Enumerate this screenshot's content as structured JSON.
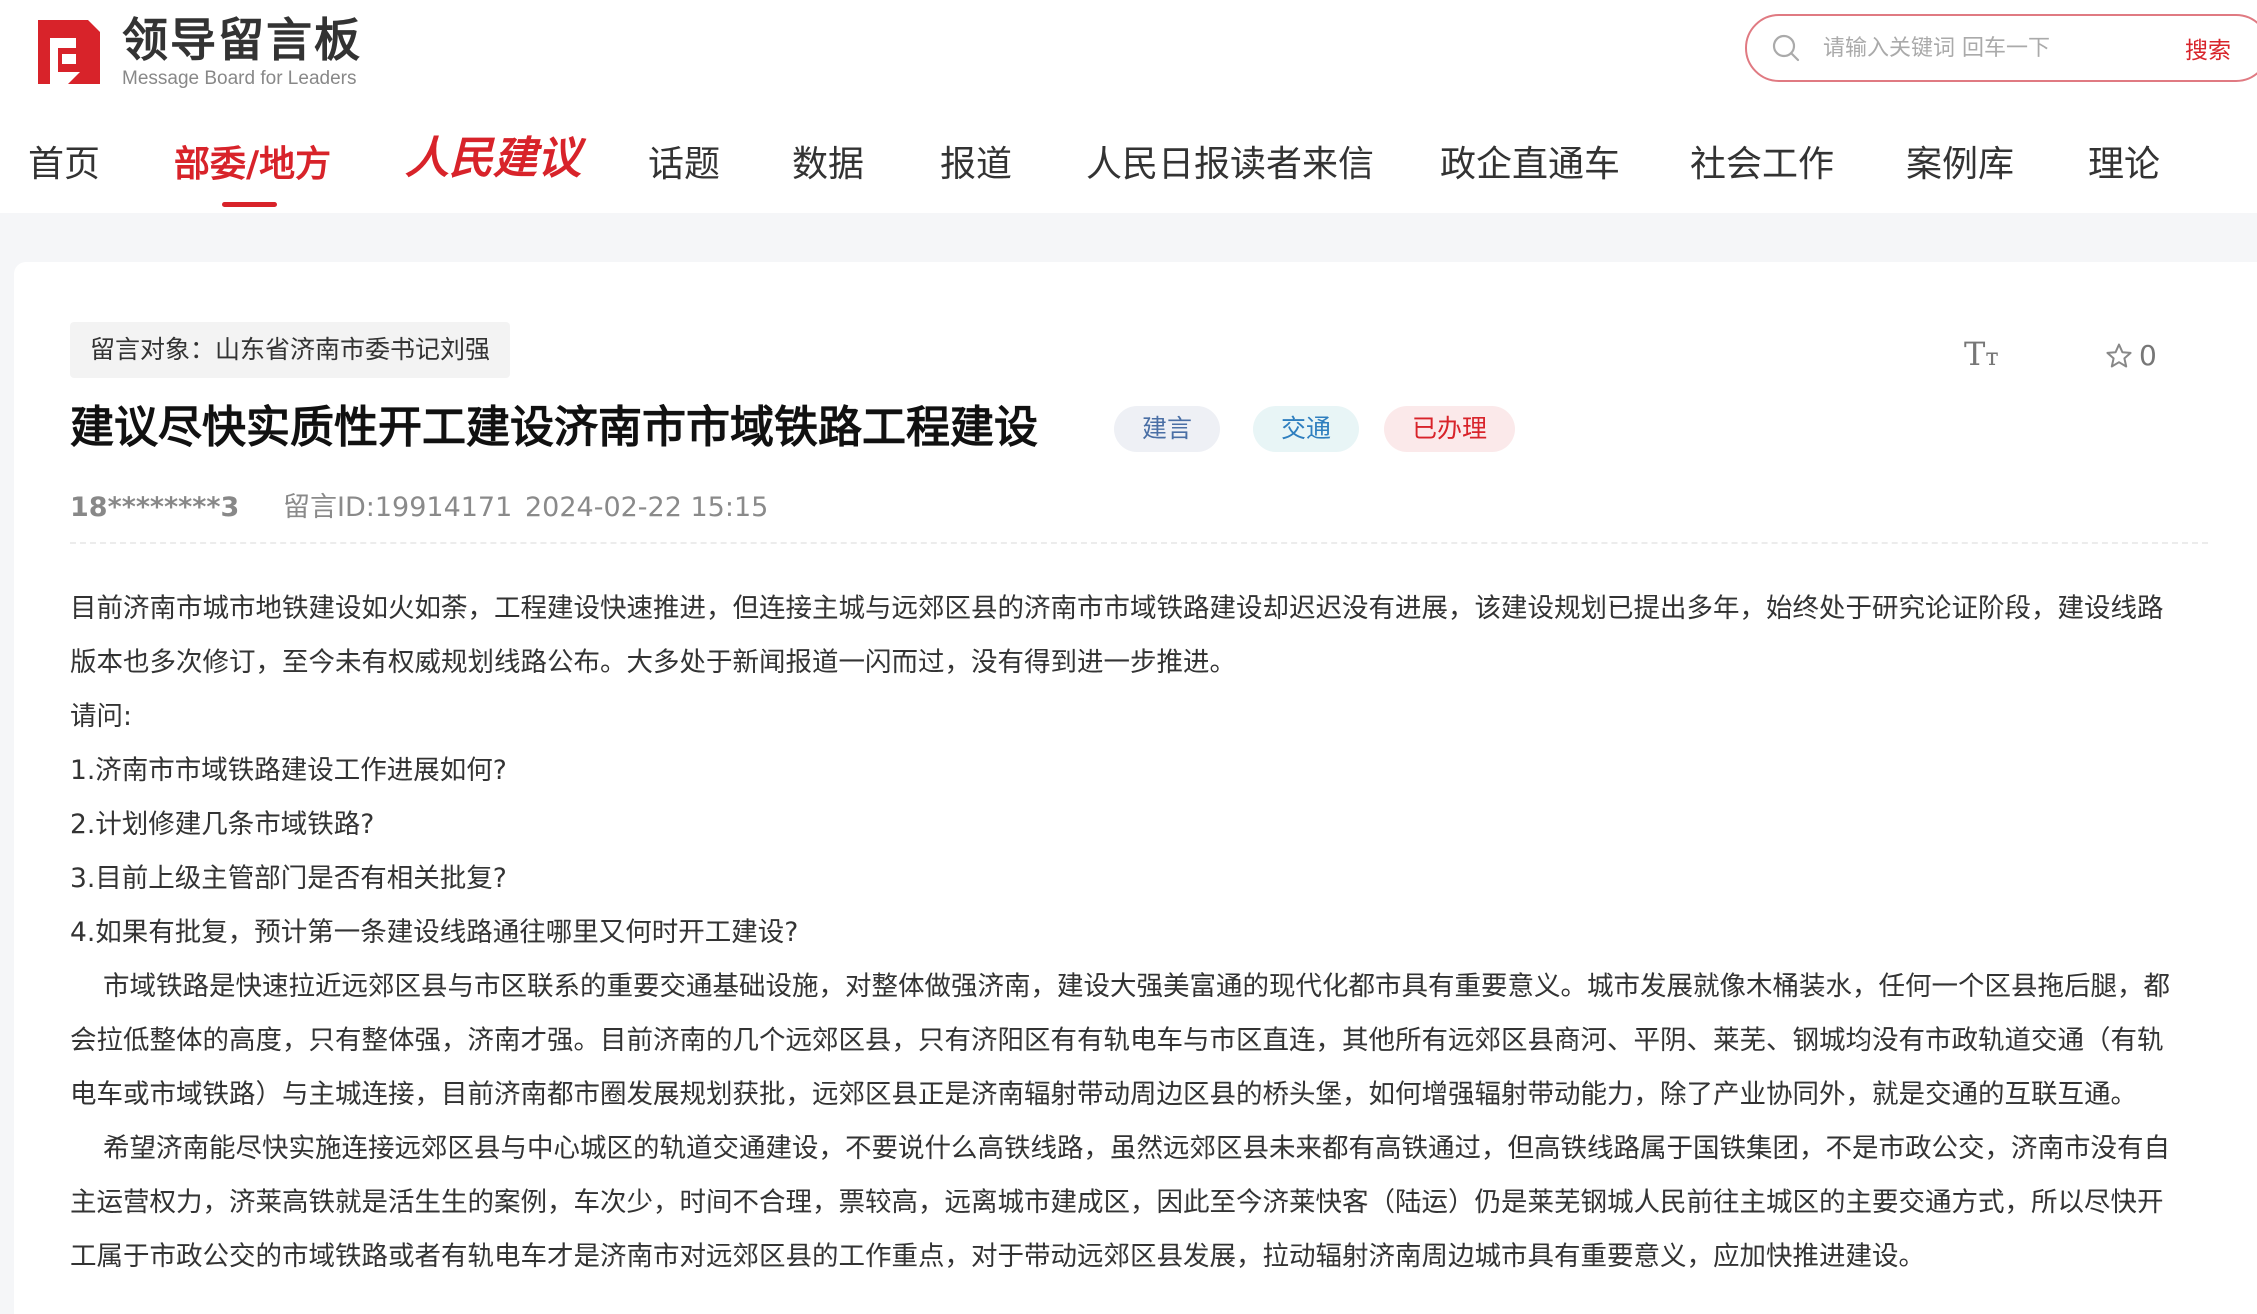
{
  "brand": {
    "logo_cn": "领导留言板",
    "logo_en": "Message Board for Leaders",
    "accent_color": "#d8232a"
  },
  "search": {
    "placeholder": "请输入关键词 回车一下",
    "button_label": "搜索",
    "icon": "search-icon"
  },
  "nav": {
    "items": [
      {
        "label": "首页"
      },
      {
        "label": "部委/地方",
        "active": true
      },
      {
        "label": "人民建议"
      },
      {
        "label": "话题"
      },
      {
        "label": "数据"
      },
      {
        "label": "报道"
      },
      {
        "label": "人民日报读者来信"
      },
      {
        "label": "政企直通车"
      },
      {
        "label": "社会工作"
      },
      {
        "label": "案例库"
      },
      {
        "label": "理论"
      }
    ]
  },
  "message": {
    "target": "留言对象：山东省济南市委书记刘强",
    "font_size_button": "Tт",
    "favorite_count": "0",
    "title": "建议尽快实质性开工建设济南市市域铁路工程建设",
    "badges": [
      "建言",
      "交通",
      "已办理"
    ],
    "user": "18********3",
    "message_id": "留言ID:19914171",
    "datetime": "2024-02-22 15:15",
    "body_lines": [
      "目前济南市城市地铁建设如火如荼，工程建设快速推进，但连接主城与远郊区县的济南市市域铁路建设却迟迟没有进展，该建设规划已提出多年，始终处于研究论证阶段，建设线路",
      "版本也多次修订，至今未有权威规划线路公布。大多处于新闻报道一闪而过，没有得到进一步推进。",
      "请问:",
      "1.济南市市域铁路建设工作进展如何?",
      "2.计划修建几条市域铁路?",
      "3.目前上级主管部门是否有相关批复?",
      "4.如果有批复，预计第一条建设线路通往哪里又何时开工建设?",
      "市域铁路是快速拉近远郊区县与市区联系的重要交通基础设施，对整体做强济南，建设大强美富通的现代化都市具有重要意义。城市发展就像木桶装水，任何一个区县拖后腿，都",
      "会拉低整体的高度，只有整体强，济南才强。目前济南的几个远郊区县，只有济阳区有有轨电车与市区直连，其他所有远郊区县商河、平阴、莱芜、钢城均没有市政轨道交通（有轨",
      "电车或市域铁路）与主城连接，目前济南都市圈发展规划获批，远郊区县正是济南辐射带动周边区县的桥头堡，如何增强辐射带动能力，除了产业协同外，就是交通的互联互通。",
      "希望济南能尽快实施连接远郊区县与中心城区的轨道交通建设，不要说什么高铁线路，虽然远郊区县未来都有高铁通过，但高铁线路属于国铁集团，不是市政公交，济南市没有自",
      "主运营权力，济莱高铁就是活生生的案例，车次少，时间不合理，票较高，远离城市建成区，因此至今济莱快客（陆运）仍是莱芜钢城人民前往主城区的主要交通方式，所以尽快开",
      "工属于市政公交的市域铁路或者有轨电车才是济南市对远郊区县的工作重点，对于带动远郊区县发展，拉动辐射济南周边城市具有重要意义，应加快推进建设。"
    ]
  }
}
